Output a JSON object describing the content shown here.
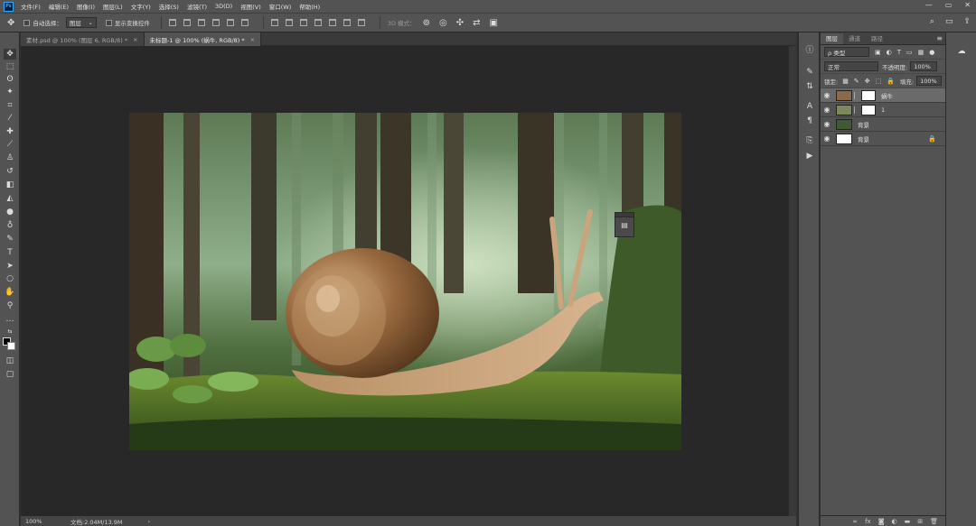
{
  "menubar": {
    "app_icon": "Ps",
    "items": [
      "文件(F)",
      "编辑(E)",
      "图像(I)",
      "图层(L)",
      "文字(Y)",
      "选择(S)",
      "滤镜(T)",
      "3D(D)",
      "视图(V)",
      "窗口(W)",
      "帮助(H)"
    ],
    "window_controls": [
      "—",
      "▭",
      "✕"
    ]
  },
  "options_bar": {
    "auto_select_label": "自动选择：",
    "auto_select_value": "图层",
    "show_transform_label": "显示变换控件",
    "mode_3d_label": "3D 模式："
  },
  "tabs": [
    {
      "label": "素材.psd @ 100% (图层 6, RGB/8) *",
      "close": "×"
    },
    {
      "label": "未标题-1 @ 100% (蜗牛, RGB/8) *",
      "close": "×"
    }
  ],
  "status": {
    "zoom": "100%",
    "doc": "文档:2.04M/13.9M",
    "arrow": "›"
  },
  "layers_panel": {
    "tabs": [
      "图层",
      "通道",
      "路径"
    ],
    "filter_kind": "ρ 类型",
    "blend_mode": "正常",
    "opacity_label": "不透明度:",
    "opacity_value": "100%",
    "lock_label": "锁定:",
    "fill_label": "填充:",
    "fill_value": "100%",
    "layers": [
      {
        "name": "蜗牛",
        "selected": true,
        "has_mask": true
      },
      {
        "name": "1",
        "selected": false,
        "has_mask": true
      },
      {
        "name": "背景",
        "selected": false,
        "has_mask": false
      },
      {
        "name": "背景",
        "selected": false,
        "has_mask": false,
        "locked": true
      }
    ]
  }
}
